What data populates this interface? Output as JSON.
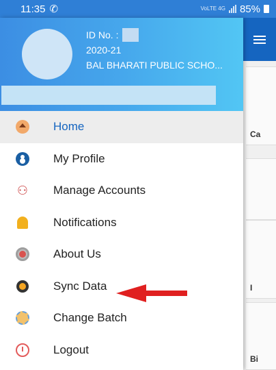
{
  "status_bar": {
    "time": "11:35",
    "notification_icon": "whatsapp-icon",
    "network": "VoLTE 4G",
    "battery": "85%"
  },
  "header": {
    "id_label": "ID No. :",
    "session": "2020-21",
    "school": "BAL BHARATI PUBLIC SCHO..."
  },
  "menu": [
    {
      "label": "Home",
      "icon": "home-icon",
      "active": true
    },
    {
      "label": "My Profile",
      "icon": "profile-icon"
    },
    {
      "label": "Manage Accounts",
      "icon": "accounts-icon"
    },
    {
      "label": "Notifications",
      "icon": "bell-icon"
    },
    {
      "label": "About Us",
      "icon": "info-icon"
    },
    {
      "label": "Sync Data",
      "icon": "sync-icon"
    },
    {
      "label": "Change Batch",
      "icon": "gear-icon"
    },
    {
      "label": "Logout",
      "icon": "power-icon"
    }
  ],
  "background": {
    "card_labels": [
      "Ca",
      "I",
      "Bi"
    ]
  },
  "colors": {
    "primary": "#1565c0",
    "header_start": "#3c8ee3",
    "header_end": "#52c6f4",
    "arrow": "#e02020"
  }
}
